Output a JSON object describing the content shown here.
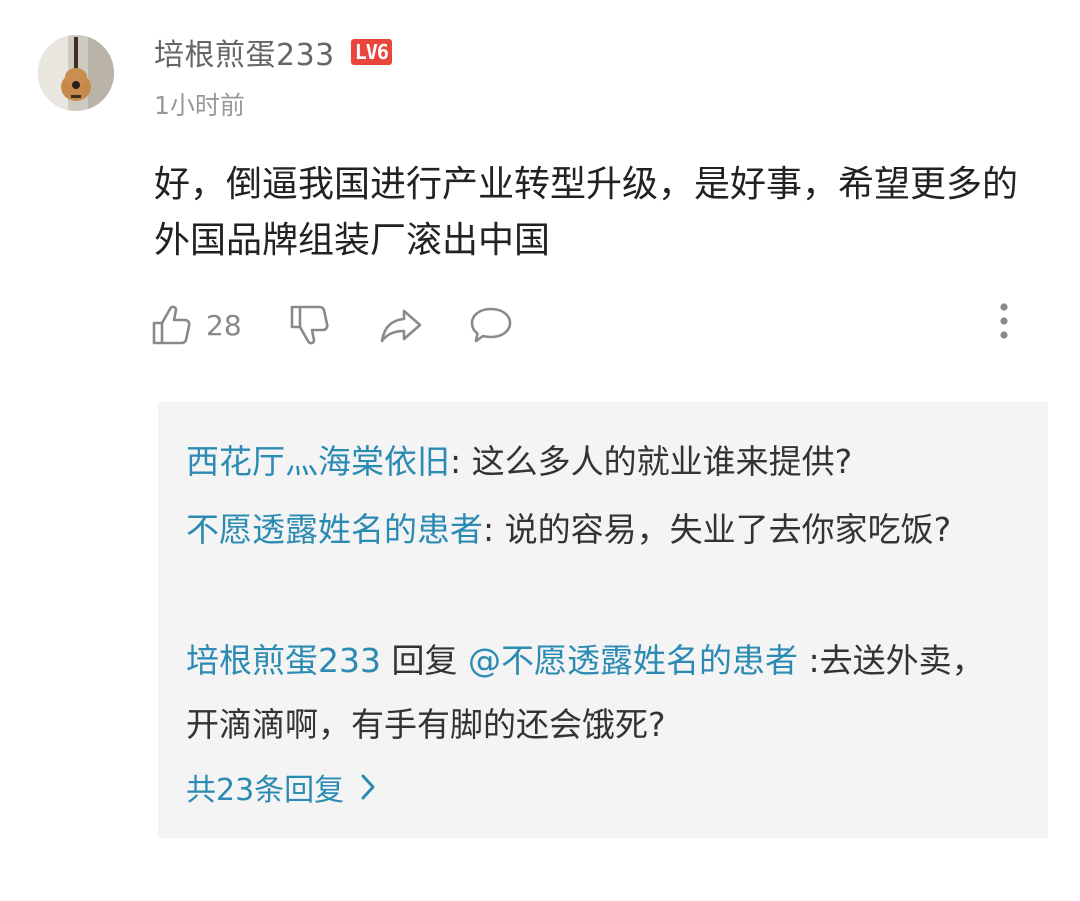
{
  "comment": {
    "username": "培根煎蛋233",
    "level_badge": "LV6",
    "timestamp": "1小时前",
    "body": "好，倒逼我国进行产业转型升级，是好事，希望更多的外国品牌组装厂滚出中国",
    "like_count": "28",
    "avatar_icon": "guitar-avatar",
    "icons": [
      "thumbs-up-icon",
      "thumbs-down-icon",
      "share-icon",
      "comment-icon",
      "more-vertical-icon"
    ]
  },
  "replies": {
    "items": [
      {
        "author": "西花厅灬海棠依旧",
        "separator": ": ",
        "text": "这么多人的就业谁来提供?"
      },
      {
        "author": "不愿透露姓名的患者",
        "separator": ": ",
        "text": "说的容易，失业了去你家吃饭?"
      },
      {
        "author": "培根煎蛋233",
        "reply_word": " 回复 ",
        "mention": "@不愿透露姓名的患者",
        "separator": " :",
        "text": "去送外卖，开滴滴啊，有手有脚的还会饿死?"
      }
    ],
    "more_label": "共23条回复"
  },
  "colors": {
    "link": "#2b8bb2",
    "badge": "#e8453c",
    "reply_bg": "#f4f4f4"
  }
}
